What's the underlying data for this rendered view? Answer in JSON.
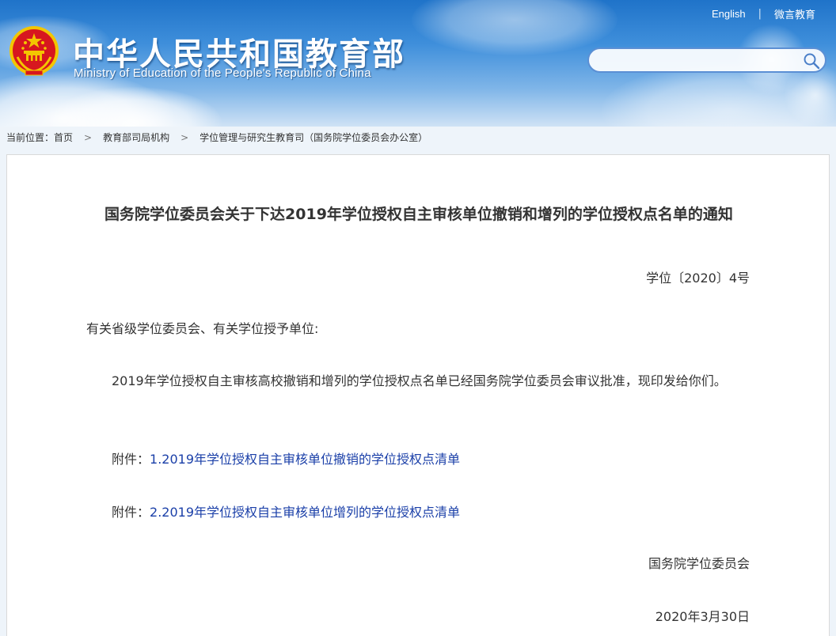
{
  "header": {
    "title": "中华人民共和国教育部",
    "subtitle": "Ministry of Education of the People's Republic of China",
    "links": {
      "english": "English",
      "weiyan": "微言教育"
    },
    "search": {
      "placeholder": ""
    }
  },
  "breadcrumb": {
    "label": "当前位置：",
    "items": [
      "首页",
      "教育部司局机构",
      "学位管理与研究生教育司（国务院学位委员会办公室）"
    ],
    "separator": ">"
  },
  "document": {
    "title": "国务院学位委员会关于下达2019年学位授权自主审核单位撤销和增列的学位授权点名单的通知",
    "number": "学位〔2020〕4号",
    "salutation": "有关省级学位委员会、有关学位授予单位:",
    "body": "2019年学位授权自主审核高校撤销和增列的学位授权点名单已经国务院学位委员会审议批准，现印发给你们。",
    "attachments": [
      {
        "prefix": "附件：",
        "link": "1.2019年学位授权自主审核单位撤销的学位授权点清单"
      },
      {
        "prefix": "附件：",
        "link": "2.2019年学位授权自主审核单位增列的学位授权点清单"
      }
    ],
    "signer": "国务院学位委员会",
    "date": "2020年3月30日"
  },
  "colors": {
    "header_blue": "#1f73c9",
    "link_blue": "#1a3fa8",
    "emblem_red": "#d7171f",
    "emblem_gold": "#f3c600"
  },
  "icons": {
    "search": "search-icon",
    "emblem": "national-emblem-icon"
  }
}
